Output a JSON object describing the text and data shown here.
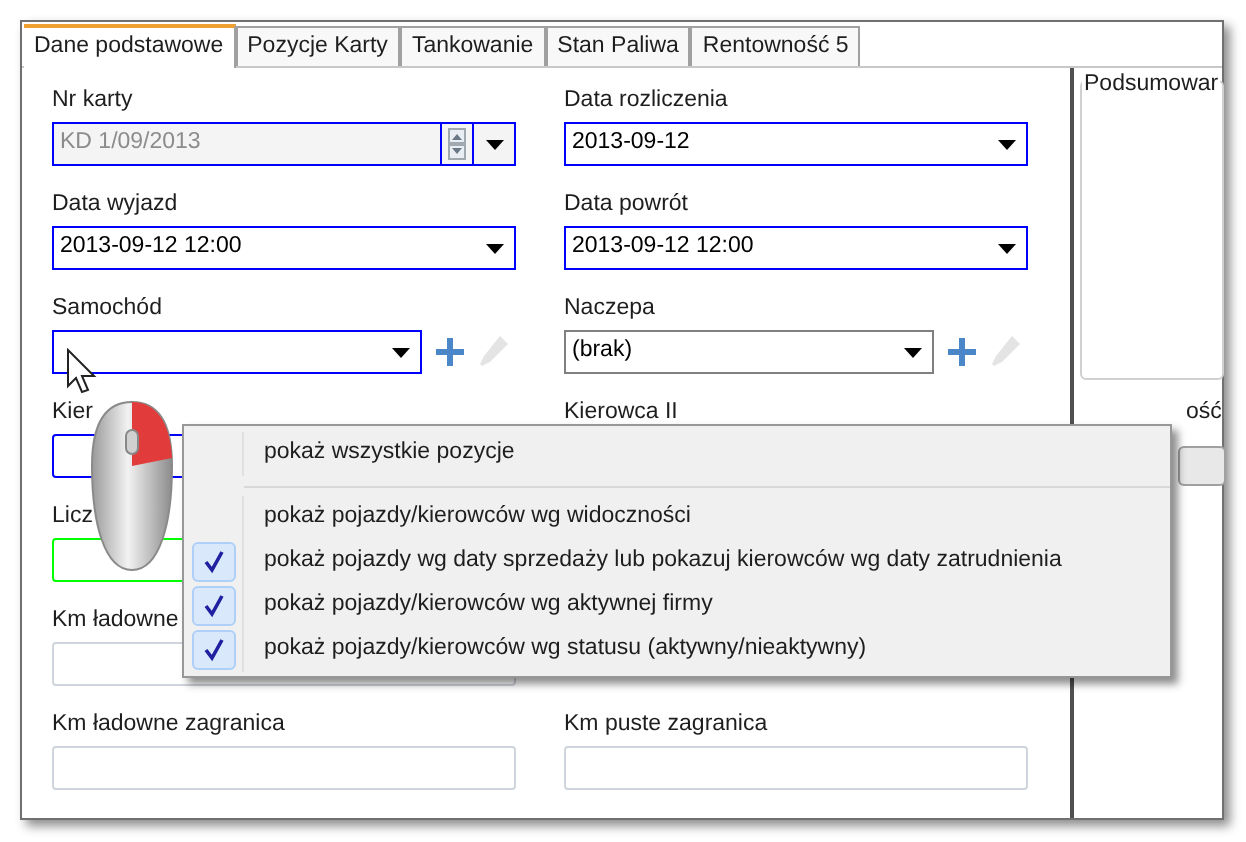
{
  "tabs": [
    {
      "label": "Dane podstawowe",
      "selected": true
    },
    {
      "label": "Pozycje Karty",
      "selected": false
    },
    {
      "label": "Tankowanie",
      "selected": false
    },
    {
      "label": "Stan Paliwa",
      "selected": false
    },
    {
      "label": "Rentowność 5",
      "selected": false
    }
  ],
  "rows": [
    {
      "left": {
        "label": "Nr karty",
        "value": "KD 1/09/2013",
        "kind": "spin_combo",
        "disabled": true,
        "color": "#0000ff",
        "actions": false
      },
      "right": {
        "label": "Data rozliczenia",
        "value": "2013-09-12",
        "kind": "combo",
        "disabled": false,
        "color": "#0000ff",
        "actions": false
      }
    },
    {
      "left": {
        "label": "Data wyjazd",
        "value": "2013-09-12 12:00",
        "kind": "combo",
        "disabled": false,
        "color": "#0000ff",
        "actions": false
      },
      "right": {
        "label": "Data powrót",
        "value": "2013-09-12 12:00",
        "kind": "combo",
        "disabled": false,
        "color": "#0000ff",
        "actions": false
      }
    },
    {
      "left": {
        "label": "Samochód",
        "kind": "combo",
        "disabled": false,
        "color": "#0000ff",
        "actions": true
      },
      "right": {
        "label": "Naczepa",
        "value": "(brak)",
        "kind": "combo",
        "disabled": false,
        "color": "#808080",
        "actions": true
      }
    },
    {
      "left": {
        "label": "Kier",
        "kind": "text",
        "disabled": false,
        "color": "#0000ff"
      },
      "right": {
        "label": "Kierowca II",
        "kind": "label"
      }
    },
    {
      "left": {
        "label": "Licz",
        "kind": "text",
        "disabled": false,
        "color": "#00ff00"
      }
    },
    {
      "left": {
        "label": "Km ładowne",
        "kind": "text",
        "color": "#d0d4dc"
      }
    },
    {
      "left": {
        "label": "Km ładowne zagranica",
        "kind": "text",
        "color": "#d0d4dc"
      },
      "right": {
        "label": "Km puste zagranica",
        "kind": "text",
        "color": "#d0d4dc"
      }
    }
  ],
  "side_panel": {
    "group_title": "Podsumowar",
    "label": "ość"
  },
  "context_menu": [
    {
      "label": "pokaż wszystkie pozycje",
      "kind": "command",
      "checked": false
    },
    {
      "label": "pokaż pojazdy/kierowców wg widoczności",
      "kind": "option",
      "checked": false
    },
    {
      "label": "pokaż pojazdy wg daty sprzedaży lub pokazuj kierowców wg daty zatrudnienia",
      "kind": "option",
      "checked": true
    },
    {
      "label": "pokaż pojazdy/kierowców wg aktywnej firmy",
      "kind": "option",
      "checked": true
    },
    {
      "label": "pokaż pojazdy/kierowców wg statusu (aktywny/nieaktywny)",
      "kind": "option",
      "checked": true
    }
  ]
}
